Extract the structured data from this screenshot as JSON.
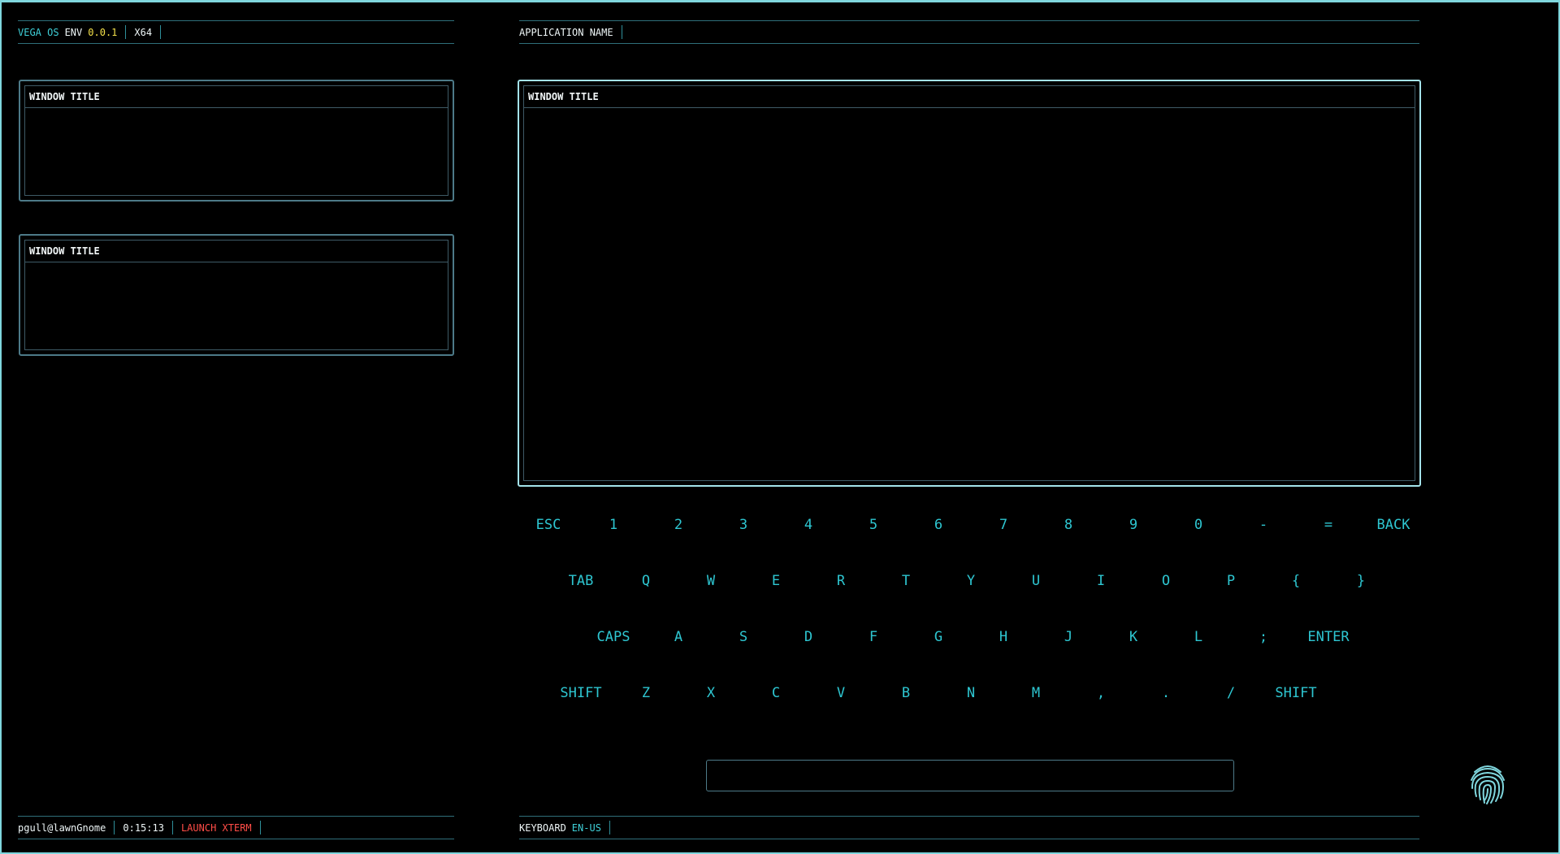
{
  "top_left_bar": {
    "os_name": "VEGA OS",
    "env_label": "ENV",
    "version": "0.0.1",
    "arch": "X64"
  },
  "top_right_bar": {
    "app_name": "APPLICATION NAME"
  },
  "windows": {
    "left_top_title": "WINDOW TITLE",
    "left_bottom_title": "WINDOW TITLE",
    "main_title": "WINDOW TITLE"
  },
  "keyboard": {
    "rows": [
      [
        "ESC",
        "1",
        "2",
        "3",
        "4",
        "5",
        "6",
        "7",
        "8",
        "9",
        "0",
        "-",
        "=",
        "BACK"
      ],
      [
        "TAB",
        "Q",
        "W",
        "E",
        "R",
        "T",
        "Y",
        "U",
        "I",
        "O",
        "P",
        "{",
        "}"
      ],
      [
        "CAPS",
        "A",
        "S",
        "D",
        "F",
        "G",
        "H",
        "J",
        "K",
        "L",
        ";",
        "ENTER"
      ],
      [
        "SHIFT",
        "Z",
        "X",
        "C",
        "V",
        "B",
        "N",
        "M",
        ",",
        ".",
        "/",
        "SHIFT"
      ]
    ],
    "input_value": "",
    "input_placeholder": ""
  },
  "bottom_left_bar": {
    "user": "pgull@lawnGnome",
    "clock": "0:15:13",
    "launch_label": "LAUNCH XTERM"
  },
  "bottom_right_bar": {
    "keyboard_label": "KEYBOARD",
    "layout": "EN-US"
  },
  "icons": {
    "fingerprint": "fingerprint-icon"
  },
  "colors": {
    "accent": "#3fd0d8",
    "frame": "#7fd6dd",
    "version": "#f3e04a",
    "launch": "#ff4d47",
    "background": "#000000"
  }
}
